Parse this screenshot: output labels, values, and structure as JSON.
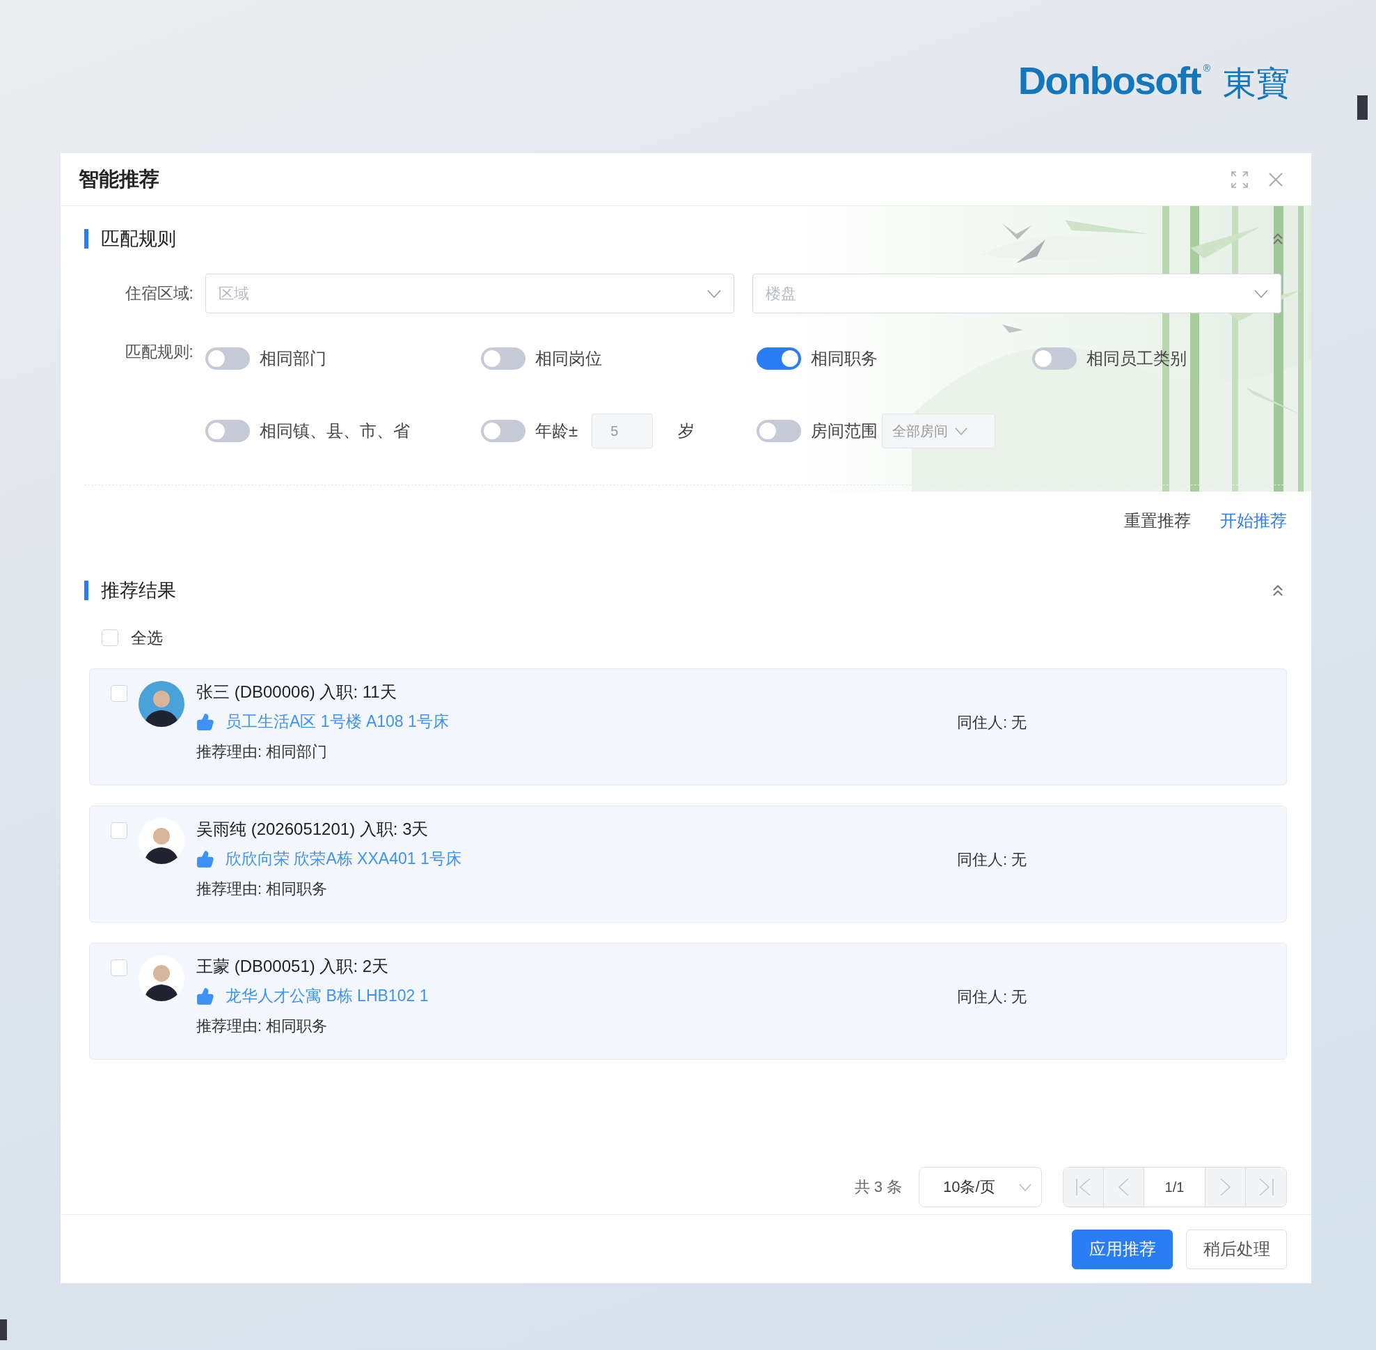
{
  "logo": {
    "wordmark": "Donbosoft",
    "registered": "®",
    "chinese": "東寶"
  },
  "dialog": {
    "title": "智能推荐"
  },
  "rules_section": {
    "title": "匹配规则",
    "expanded": true,
    "area_label": "住宿区域:",
    "area_fields": [
      {
        "placeholder": "区域"
      },
      {
        "placeholder": "楼盘"
      }
    ],
    "rules_label": "匹配规则:",
    "rules": [
      {
        "kind": "toggle",
        "label": "相同部门",
        "on": false
      },
      {
        "kind": "toggle",
        "label": "相同岗位",
        "on": false
      },
      {
        "kind": "toggle",
        "label": "相同职务",
        "on": true
      },
      {
        "kind": "toggle",
        "label": "相同员工类别",
        "on": false
      },
      {
        "kind": "toggle",
        "label": "相同镇、县、市、省",
        "on": false
      },
      {
        "kind": "age",
        "label": "年龄±",
        "on": false,
        "value": "5",
        "unit": "岁"
      },
      {
        "kind": "room",
        "label": "房间范围",
        "on": false,
        "value": "全部房间"
      }
    ],
    "actions": [
      {
        "label": "重置推荐",
        "primary": false
      },
      {
        "label": "开始推荐",
        "primary": true
      }
    ]
  },
  "results_section": {
    "title": "推荐结果",
    "expanded": true,
    "select_all": {
      "label": "全选",
      "checked": false
    },
    "items": [
      {
        "heading": "张三 (DB00006) 入职: 11天",
        "room": "员工生活A区 1号楼 A108 1号床",
        "reason": "推荐理由: 相同部门",
        "roommate": "同住人: 无",
        "checked": false,
        "color": "#4aa3d8"
      },
      {
        "heading": "吴雨纯 (2026051201) 入职: 3天",
        "room": "欣欣向荣 欣荣A栋 XXA401 1号床",
        "reason": "推荐理由: 相同职务",
        "roommate": "同住人: 无",
        "checked": false,
        "color": "#ffffff"
      },
      {
        "heading": "王蒙 (DB00051) 入职: 2天",
        "room": "龙华人才公寓 B栋 LHB102 1",
        "reason": "推荐理由: 相同职务",
        "roommate": "同住人: 无",
        "checked": false,
        "color": "#ffffff"
      }
    ]
  },
  "pagination": {
    "total": "共 3 条",
    "page_size": "10条/页",
    "page": "1/1",
    "prev_disabled": true,
    "next_disabled": true
  },
  "footer_buttons": [
    {
      "label": "应用推荐",
      "primary": true
    },
    {
      "label": "稍后处理",
      "primary": false
    }
  ]
}
